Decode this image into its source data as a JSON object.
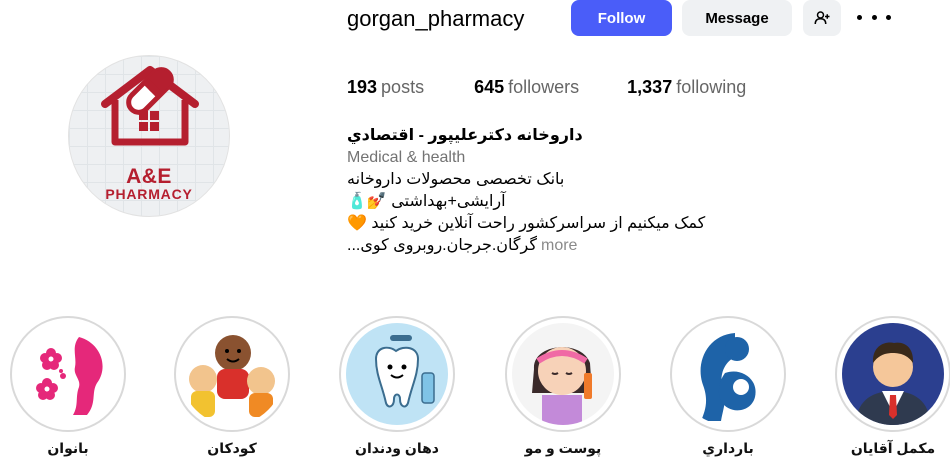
{
  "profile": {
    "username": "gorgan_pharmacy",
    "logo_line_1": "A&E",
    "logo_line_2": "PHARMACY",
    "follow_label": "Follow",
    "message_label": "Message",
    "brand_color": "#b51f2f",
    "follow_color": "#4a5df9"
  },
  "stats": {
    "posts_count": "193",
    "posts_label": "posts",
    "followers_count": "645",
    "followers_label": "followers",
    "following_count": "1,337",
    "following_label": "following"
  },
  "bio": {
    "name": "داروخانه دکترعلیپور - اقتصادي",
    "category": "Medical & health",
    "line1": "بانک تخصصی محصولات داروخانه",
    "line2": "آرایشی+بهداشتی 💅🧴",
    "line3": "کمک میکنیم از سراسرکشور راحت آنلاین خرید کنید 🧡",
    "line4": "گرگان.جرجان.روبروی کوی...",
    "more_label": "more"
  },
  "highlights": [
    {
      "label": "بانوان",
      "icon": "woman-flower-icon"
    },
    {
      "label": "کودکان",
      "icon": "kids-icon"
    },
    {
      "label": "دهان ودندان",
      "icon": "tooth-icon"
    },
    {
      "label": "پوست و مو",
      "icon": "girl-skincare-icon"
    },
    {
      "label": "بارداري",
      "icon": "mother-baby-icon"
    },
    {
      "label": "مکمل آقایان",
      "icon": "man-avatar-icon"
    }
  ]
}
